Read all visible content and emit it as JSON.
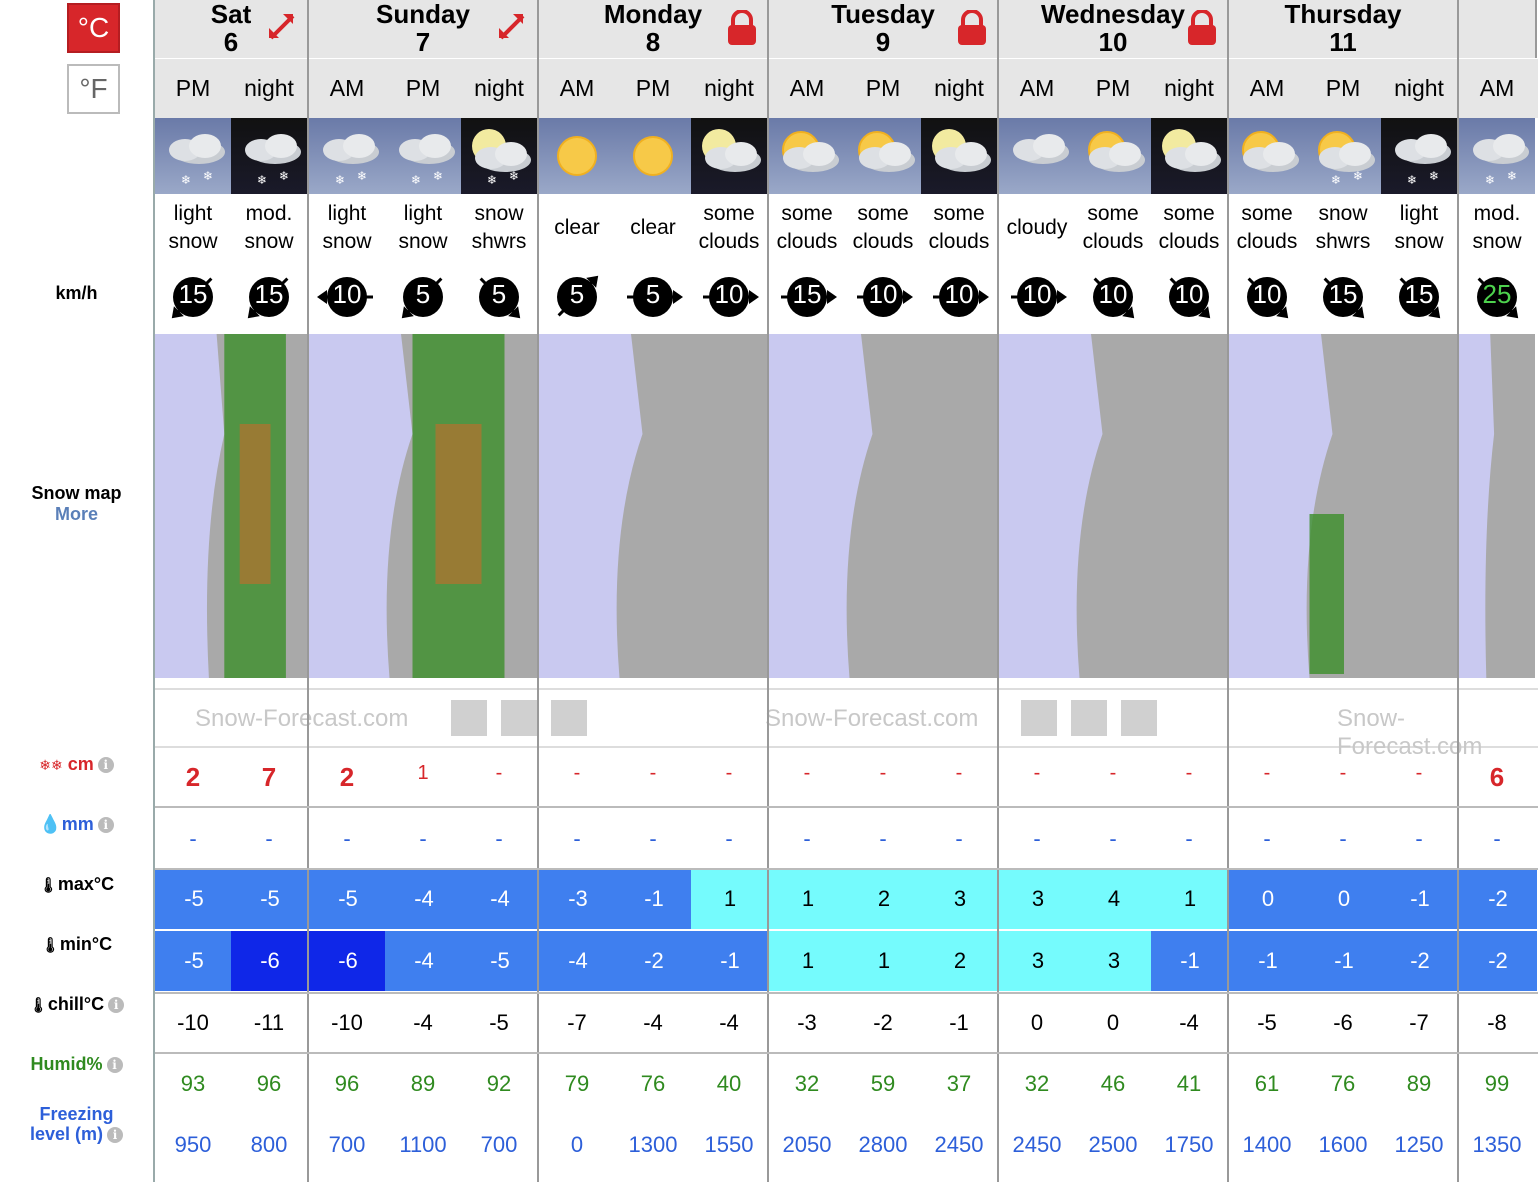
{
  "units": {
    "celsius": "°C",
    "fahrenheit": "°F"
  },
  "labels": {
    "wind": "km/h",
    "snowmap": "Snow map",
    "snowmap_more": "More",
    "snow": "cm",
    "rain": "mm",
    "max": "max°C",
    "min": "min°C",
    "chill": "chill°C",
    "humid": "Humid%",
    "freezing_1": "Freezing",
    "freezing_2": "level (m)",
    "info": "i"
  },
  "brand": "Snow-Forecast.com",
  "colors": {
    "snow_red": "#d7262a",
    "mid_blue": "#3f7fef",
    "dark_blue": "#0f27e8",
    "cyan": "#75fbfd",
    "humid_green": "#2f8a1f",
    "freeze_blue": "#2d5fd9"
  },
  "days": [
    {
      "name": "Sat",
      "num": "6",
      "icon": "expand-icon",
      "cols": 2
    },
    {
      "name": "Sunday",
      "num": "7",
      "icon": "expand-icon",
      "cols": 3
    },
    {
      "name": "Monday",
      "num": "8",
      "icon": "lock-icon",
      "cols": 3
    },
    {
      "name": "Tuesday",
      "num": "9",
      "icon": "lock-icon",
      "cols": 3
    },
    {
      "name": "Wednesday",
      "num": "10",
      "icon": "lock-icon",
      "cols": 3
    },
    {
      "name": "Thursday",
      "num": "11",
      "icon": "none",
      "cols": 3
    },
    {
      "name": "",
      "num": "",
      "icon": "none",
      "cols": 1
    }
  ],
  "periods": [
    {
      "p": "PM",
      "wx": "cloud-snow",
      "text": [
        "light",
        "snow"
      ],
      "wind": "15",
      "dir": "sw",
      "snow": "2",
      "rain": "-",
      "max": "-5",
      "min": "-5",
      "chill": "-10",
      "humid": "93",
      "freeze": "950"
    },
    {
      "p": "night",
      "wx": "cloud-snow-night",
      "text": [
        "mod.",
        "snow"
      ],
      "wind": "15",
      "dir": "sw",
      "snow": "7",
      "rain": "-",
      "max": "-5",
      "min": "-6",
      "chill": "-11",
      "humid": "96",
      "freeze": "800"
    },
    {
      "p": "AM",
      "wx": "cloud-snow",
      "text": [
        "light",
        "snow"
      ],
      "wind": "10",
      "dir": "w",
      "snow": "2",
      "rain": "-",
      "max": "-5",
      "min": "-6",
      "chill": "-10",
      "humid": "96",
      "freeze": "700"
    },
    {
      "p": "PM",
      "wx": "cloud-snow",
      "text": [
        "light",
        "snow"
      ],
      "wind": "5",
      "dir": "sw",
      "snow": "1",
      "rain": "-",
      "max": "-4",
      "min": "-4",
      "chill": "-4",
      "humid": "89",
      "freeze": "1100"
    },
    {
      "p": "night",
      "wx": "moon-cloud-snow",
      "text": [
        "snow",
        "shwrs"
      ],
      "wind": "5",
      "dir": "se",
      "snow": "-",
      "rain": "-",
      "max": "-4",
      "min": "-5",
      "chill": "-5",
      "humid": "92",
      "freeze": "700"
    },
    {
      "p": "AM",
      "wx": "sun",
      "text": [
        "clear"
      ],
      "wind": "5",
      "dir": "ne",
      "snow": "-",
      "rain": "-",
      "max": "-3",
      "min": "-4",
      "chill": "-7",
      "humid": "79",
      "freeze": "0"
    },
    {
      "p": "PM",
      "wx": "sun",
      "text": [
        "clear"
      ],
      "wind": "5",
      "dir": "e",
      "snow": "-",
      "rain": "-",
      "max": "-1",
      "min": "-2",
      "chill": "-4",
      "humid": "76",
      "freeze": "1300"
    },
    {
      "p": "night",
      "wx": "moon-cloud",
      "text": [
        "some",
        "clouds"
      ],
      "wind": "10",
      "dir": "e",
      "snow": "-",
      "rain": "-",
      "max": "1",
      "min": "-1",
      "chill": "-4",
      "humid": "40",
      "freeze": "1550"
    },
    {
      "p": "AM",
      "wx": "sun-cloud",
      "text": [
        "some",
        "clouds"
      ],
      "wind": "15",
      "dir": "e",
      "snow": "-",
      "rain": "-",
      "max": "1",
      "min": "1",
      "chill": "-3",
      "humid": "32",
      "freeze": "2050"
    },
    {
      "p": "PM",
      "wx": "sun-cloud",
      "text": [
        "some",
        "clouds"
      ],
      "wind": "10",
      "dir": "e",
      "snow": "-",
      "rain": "-",
      "max": "2",
      "min": "1",
      "chill": "-2",
      "humid": "59",
      "freeze": "2800"
    },
    {
      "p": "night",
      "wx": "moon-cloud",
      "text": [
        "some",
        "clouds"
      ],
      "wind": "10",
      "dir": "e",
      "snow": "-",
      "rain": "-",
      "max": "3",
      "min": "2",
      "chill": "-1",
      "humid": "37",
      "freeze": "2450"
    },
    {
      "p": "AM",
      "wx": "cloud",
      "text": [
        "cloudy"
      ],
      "wind": "10",
      "dir": "e",
      "snow": "-",
      "rain": "-",
      "max": "3",
      "min": "3",
      "chill": "0",
      "humid": "32",
      "freeze": "2450"
    },
    {
      "p": "PM",
      "wx": "sun-cloud",
      "text": [
        "some",
        "clouds"
      ],
      "wind": "10",
      "dir": "se",
      "snow": "-",
      "rain": "-",
      "max": "4",
      "min": "3",
      "chill": "0",
      "humid": "46",
      "freeze": "2500"
    },
    {
      "p": "night",
      "wx": "moon-cloud",
      "text": [
        "some",
        "clouds"
      ],
      "wind": "10",
      "dir": "se",
      "snow": "-",
      "rain": "-",
      "max": "1",
      "min": "-1",
      "chill": "-4",
      "humid": "41",
      "freeze": "1750"
    },
    {
      "p": "AM",
      "wx": "sun-cloud",
      "text": [
        "some",
        "clouds"
      ],
      "wind": "10",
      "dir": "se",
      "snow": "-",
      "rain": "-",
      "max": "0",
      "min": "-1",
      "chill": "-5",
      "humid": "61",
      "freeze": "1400"
    },
    {
      "p": "PM",
      "wx": "sun-cloud-snow",
      "text": [
        "snow",
        "shwrs"
      ],
      "wind": "15",
      "dir": "se",
      "snow": "-",
      "rain": "-",
      "max": "0",
      "min": "-1",
      "chill": "-6",
      "humid": "76",
      "freeze": "1600"
    },
    {
      "p": "night",
      "wx": "cloud-snow-night",
      "text": [
        "light",
        "snow"
      ],
      "wind": "15",
      "dir": "se",
      "snow": "-",
      "rain": "-",
      "max": "-1",
      "min": "-2",
      "chill": "-7",
      "humid": "89",
      "freeze": "1250"
    },
    {
      "p": "AM",
      "wx": "cloud-snow",
      "text": [
        "mod.",
        "snow"
      ],
      "wind": "25",
      "dir": "se",
      "snow": "6",
      "rain": "-",
      "max": "-2",
      "min": "-2",
      "chill": "-8",
      "humid": "99",
      "freeze": "1350"
    }
  ]
}
